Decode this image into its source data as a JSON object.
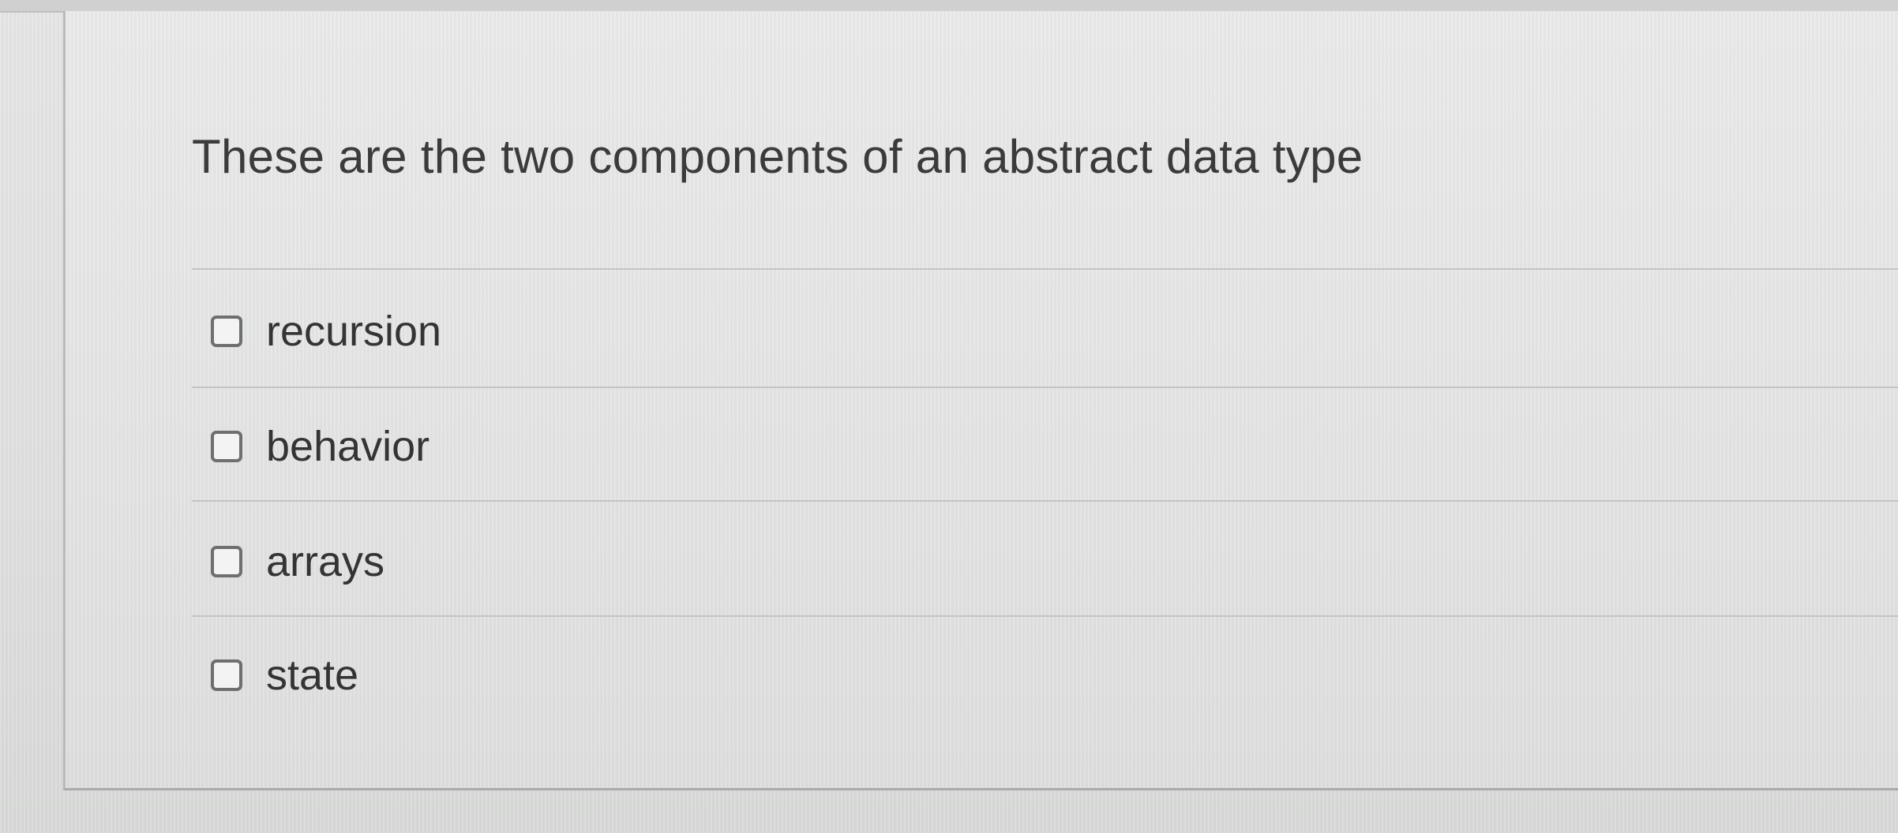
{
  "question": {
    "text": "These are the two components of an abstract data type"
  },
  "options": [
    {
      "label": "recursion",
      "checked": false
    },
    {
      "label": "behavior",
      "checked": false
    },
    {
      "label": "arrays",
      "checked": false
    },
    {
      "label": "state",
      "checked": false
    }
  ],
  "icons": {
    "checkbox": "empty-checkbox-icon"
  }
}
